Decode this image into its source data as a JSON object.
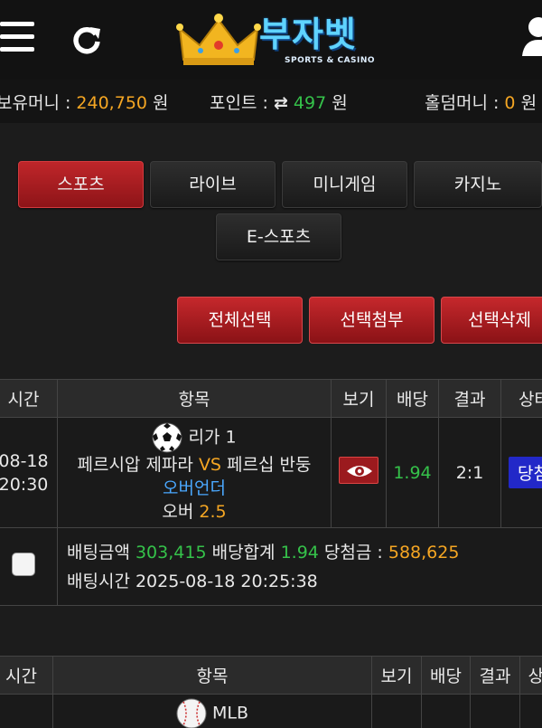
{
  "header": {
    "logo_text": "부자벳",
    "logo_sub": "SPORTS & CASINO"
  },
  "balance": {
    "money_label": "보유머니 :",
    "money_value": "240,750",
    "money_unit": "원",
    "point_label": "포인트 :",
    "point_icon": "⇄",
    "point_value": "497",
    "point_unit": "원",
    "hold_label": "홀덤머니 :",
    "hold_value": "0",
    "hold_unit": "원"
  },
  "categories": [
    "스포츠",
    "라이브",
    "미니게임",
    "카지노",
    "E-스포츠"
  ],
  "actions": [
    "전체선택",
    "선택첨부",
    "선택삭제"
  ],
  "columns": [
    "시간",
    "항목",
    "보기",
    "배당",
    "결과",
    "상태"
  ],
  "bets": [
    {
      "date": "08-18",
      "time": "20:30",
      "league": "리가 1",
      "home": "페르시압 제파라",
      "vs": "VS",
      "away": "페르십 반둥",
      "market": "오버언더",
      "pick": "오버",
      "line": "2.5",
      "odds": "1.94",
      "result": "2:1",
      "status": "당첨",
      "amount_label": "배팅금액",
      "amount": "303,415",
      "odds_total_label": "배당합계",
      "odds_total": "1.94",
      "win_label": "당첨금 :",
      "win": "588,625",
      "bet_time_label": "배팅시간",
      "bet_time": "2025-08-18 20:25:38"
    },
    {
      "league": "MLB"
    }
  ],
  "colors": {
    "accent_red": "#b81f23",
    "orange": "#f5a623",
    "green": "#35c24a",
    "blue": "#4aa8ff",
    "status_blue": "#2228c8"
  }
}
